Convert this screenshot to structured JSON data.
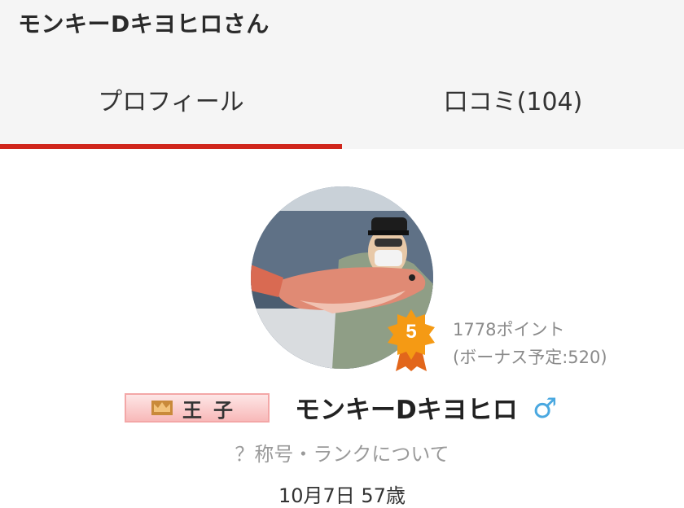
{
  "header": {
    "title": "モンキーDキヨヒロさん"
  },
  "tabs": [
    {
      "label": "プロフィール",
      "active": true
    },
    {
      "label": "口コミ(104)",
      "active": false
    }
  ],
  "profile": {
    "rank_level": "5",
    "points": "1778ポイント",
    "bonus": "(ボーナス予定:520)",
    "title_badge": "王子",
    "name": "モンキーDキヨヒロ",
    "gender_symbol": "♂",
    "rank_link": "？称号・ランクについて",
    "birthday_age": "10月7日 57歳"
  },
  "colors": {
    "accent": "#d0261c",
    "gender": "#4aa8e0",
    "badge": "#f59a14"
  }
}
